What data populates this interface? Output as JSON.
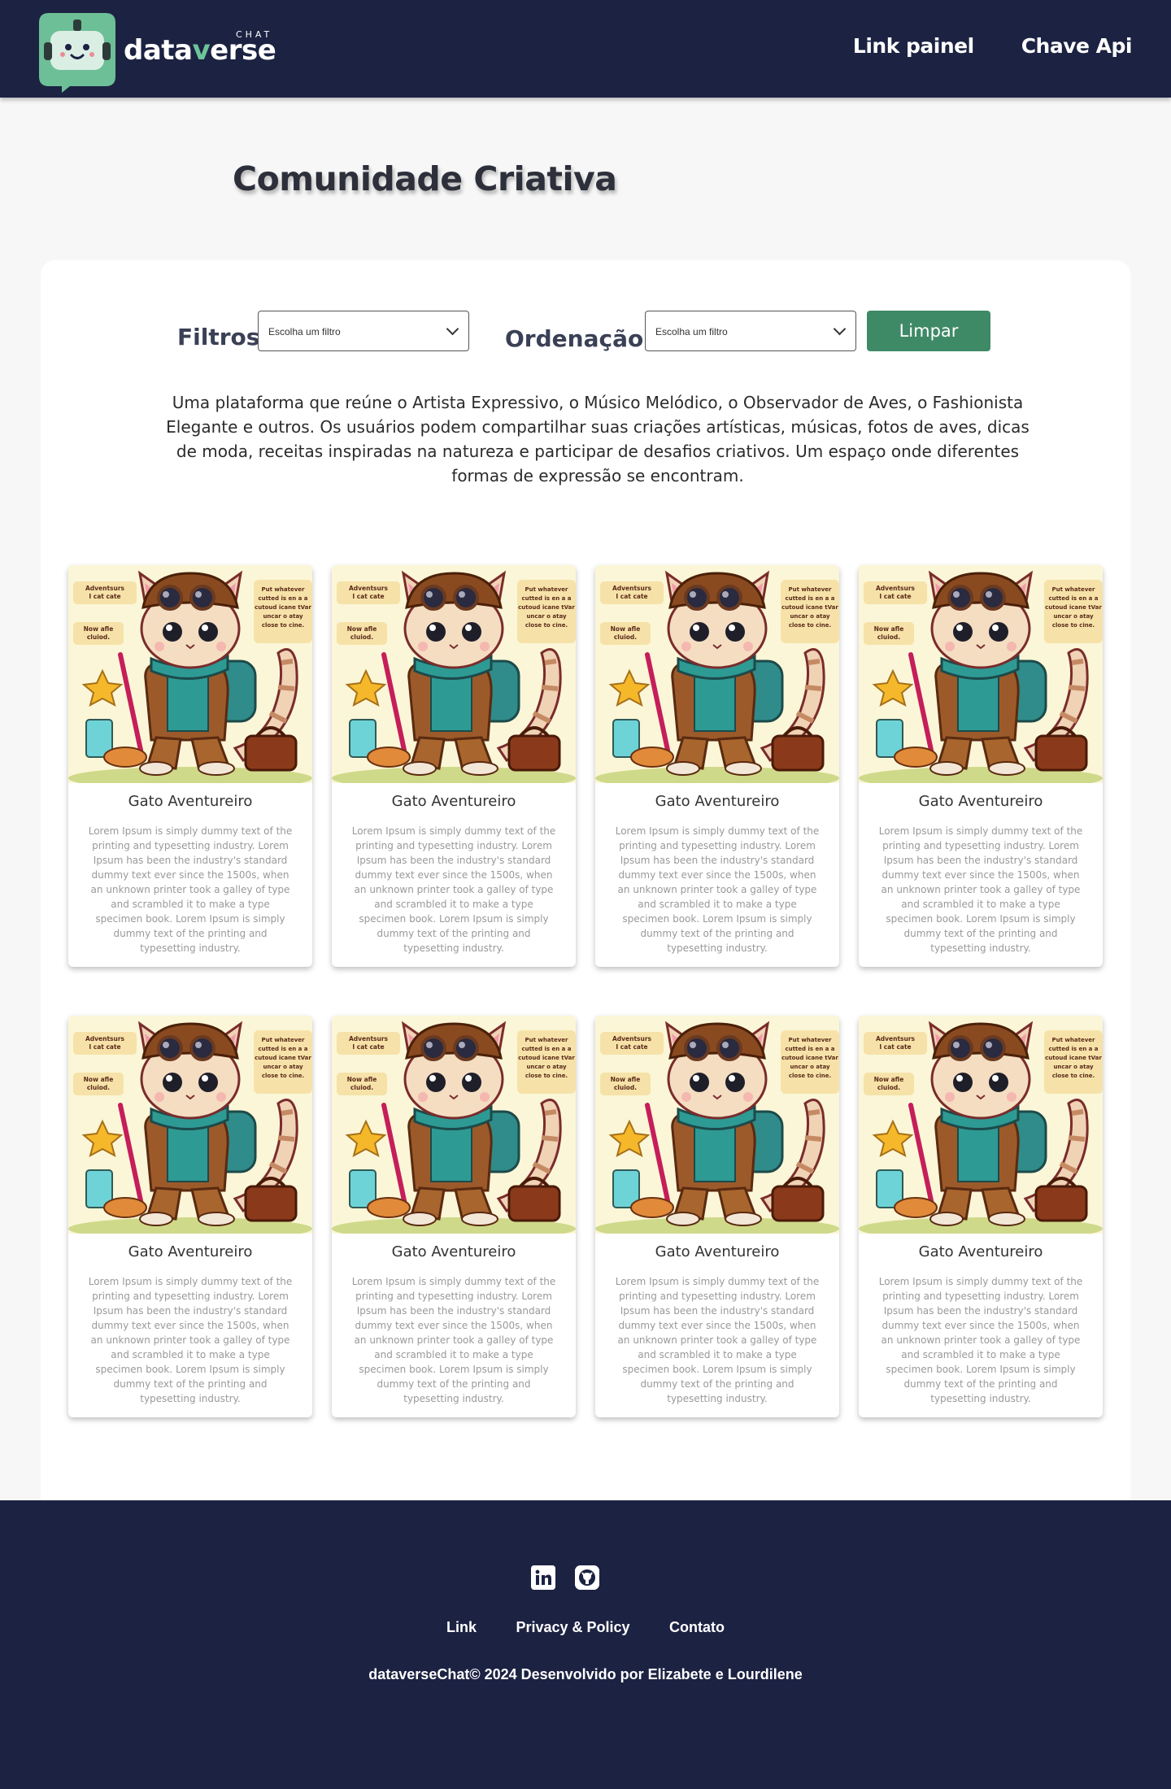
{
  "header": {
    "logo_chat": "CHAT",
    "logo_word_a": "data",
    "logo_word_b": "v",
    "logo_word_c": "erse",
    "nav": [
      {
        "label": "Link painel"
      },
      {
        "label": "Chave Api"
      }
    ]
  },
  "page": {
    "title": "Comunidade Criativa"
  },
  "filters": {
    "filter_label": "Filtros",
    "filter_select_value": "Escolha um filtro",
    "order_label": "Ordenação",
    "order_select_value": "Escolha um filtro",
    "clear_button": "Limpar"
  },
  "description": "Uma plataforma que reúne o Artista Expressivo, o Músico Melódico, o Observador de Aves, o Fashionista Elegante e outros. Os usuários podem compartilhar suas criações artísticas, músicas, fotos de aves, dicas de moda, receitas inspiradas na natureza e participar de desafios criativos. Um espaço onde diferentes formas de expressão se encontram.",
  "cards": [
    {
      "title": "Gato Aventureiro",
      "text": "Lorem Ipsum is simply dummy text of the printing and typesetting industry. Lorem Ipsum has been the industry's standard dummy text ever since the 1500s, when an unknown printer took a galley of type and scrambled it to make a type specimen book. Lorem Ipsum is simply dummy text of the printing and typesetting industry."
    },
    {
      "title": "Gato Aventureiro",
      "text": "Lorem Ipsum is simply dummy text of the printing and typesetting industry. Lorem Ipsum has been the industry's standard dummy text ever since the 1500s, when an unknown printer took a galley of type and scrambled it to make a type specimen book. Lorem Ipsum is simply dummy text of the printing and typesetting industry."
    },
    {
      "title": "Gato Aventureiro",
      "text": "Lorem Ipsum is simply dummy text of the printing and typesetting industry. Lorem Ipsum has been the industry's standard dummy text ever since the 1500s, when an unknown printer took a galley of type and scrambled it to make a type specimen book. Lorem Ipsum is simply dummy text of the printing and typesetting industry."
    },
    {
      "title": "Gato Aventureiro",
      "text": "Lorem Ipsum is simply dummy text of the printing and typesetting industry. Lorem Ipsum has been the industry's standard dummy text ever since the 1500s, when an unknown printer took a galley of type and scrambled it to make a type specimen book. Lorem Ipsum is simply dummy text of the printing and typesetting industry."
    },
    {
      "title": "Gato Aventureiro",
      "text": "Lorem Ipsum is simply dummy text of the printing and typesetting industry. Lorem Ipsum has been the industry's standard dummy text ever since the 1500s, when an unknown printer took a galley of type and scrambled it to make a type specimen book. Lorem Ipsum is simply dummy text of the printing and typesetting industry."
    },
    {
      "title": "Gato Aventureiro",
      "text": "Lorem Ipsum is simply dummy text of the printing and typesetting industry. Lorem Ipsum has been the industry's standard dummy text ever since the 1500s, when an unknown printer took a galley of type and scrambled it to make a type specimen book. Lorem Ipsum is simply dummy text of the printing and typesetting industry."
    },
    {
      "title": "Gato Aventureiro",
      "text": "Lorem Ipsum is simply dummy text of the printing and typesetting industry. Lorem Ipsum has been the industry's standard dummy text ever since the 1500s, when an unknown printer took a galley of type and scrambled it to make a type specimen book. Lorem Ipsum is simply dummy text of the printing and typesetting industry."
    },
    {
      "title": "Gato Aventureiro",
      "text": "Lorem Ipsum is simply dummy text of the printing and typesetting industry. Lorem Ipsum has been the industry's standard dummy text ever since the 1500s, when an unknown printer took a galley of type and scrambled it to make a type specimen book. Lorem Ipsum is simply dummy text of the printing and typesetting industry."
    }
  ],
  "card_image": {
    "bubble_left_1": "Adventsurs I cat cate",
    "bubble_left_2": "Now afle cluiod.",
    "bubble_right": "Put whatever cutted is en a a cutoud icane tVar uncar o atay close to cine."
  },
  "footer": {
    "icons": [
      "linkedin-icon",
      "github-icon"
    ],
    "links": [
      {
        "label": "Link"
      },
      {
        "label": "Privacy & Policy"
      },
      {
        "label": "Contato"
      }
    ],
    "copyright": "dataverseChat© 2024 Desenvolvido por Elizabete e Lourdilene"
  },
  "colors": {
    "header_bg": "#1c2242",
    "accent": "#3f8a66",
    "logo_green": "#6cc49a"
  }
}
